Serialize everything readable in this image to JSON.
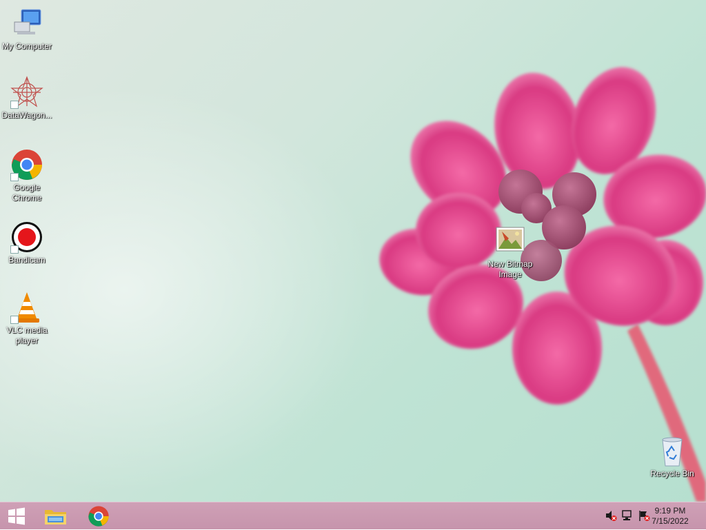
{
  "desktop": {
    "icons": [
      {
        "label": "My Computer",
        "icon": "computer-icon"
      },
      {
        "label": "DataWagon...",
        "icon": "datawagon-icon"
      },
      {
        "label": "Google Chrome",
        "icon": "chrome-icon"
      },
      {
        "label": "Bandicam",
        "icon": "bandicam-icon"
      },
      {
        "label": "VLC media player",
        "icon": "vlc-icon"
      },
      {
        "label": "New Bitmap Image",
        "icon": "bitmap-image-icon"
      },
      {
        "label": "Recycle Bin",
        "icon": "recycle-bin-icon"
      }
    ]
  },
  "taskbar": {
    "pinned": [
      {
        "name": "Start",
        "icon": "windows-logo-icon"
      },
      {
        "name": "File Explorer",
        "icon": "folder-icon"
      },
      {
        "name": "Google Chrome",
        "icon": "chrome-icon"
      }
    ],
    "tray": {
      "icons": [
        "speaker-muted-icon",
        "network-icon",
        "action-center-flag-icon"
      ],
      "time": "9:19 PM",
      "date": "7/15/2022"
    }
  },
  "colors": {
    "taskbar": "#c694ac",
    "flower": "#e04a8c",
    "label_text": "#ffffff"
  }
}
